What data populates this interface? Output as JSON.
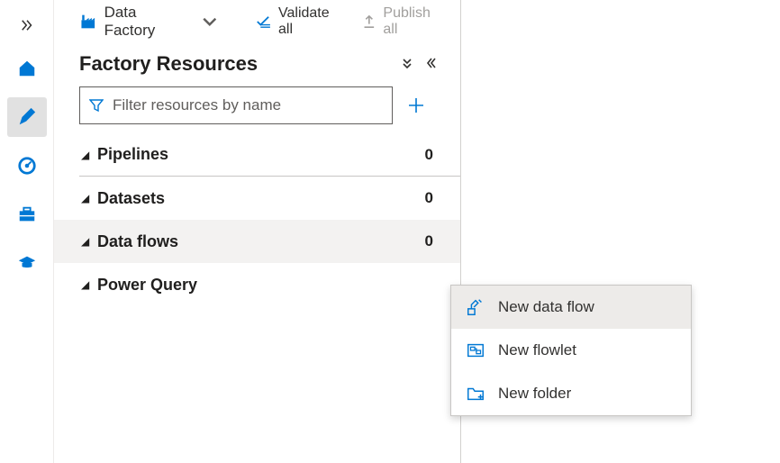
{
  "toolbar": {
    "brand_label": "Data Factory",
    "validate_label": "Validate all",
    "publish_label": "Publish all"
  },
  "panel": {
    "title": "Factory Resources"
  },
  "filter": {
    "placeholder": "Filter resources by name"
  },
  "tree": {
    "items": [
      {
        "label": "Pipelines",
        "count": "0",
        "hovered": false,
        "underline": true
      },
      {
        "label": "Datasets",
        "count": "0",
        "hovered": false,
        "underline": false
      },
      {
        "label": "Data flows",
        "count": "0",
        "hovered": true,
        "underline": false
      },
      {
        "label": "Power Query",
        "count": "",
        "hovered": false,
        "underline": false
      }
    ]
  },
  "context_menu": {
    "items": [
      {
        "label": "New data flow"
      },
      {
        "label": "New flowlet"
      },
      {
        "label": "New folder"
      }
    ]
  }
}
